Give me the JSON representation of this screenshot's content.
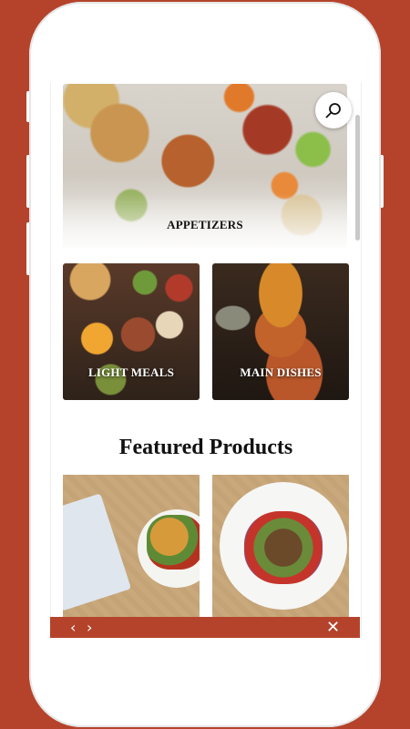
{
  "colors": {
    "accent": "#b5432b",
    "frame": "#ffffff"
  },
  "categories": [
    {
      "label": "APPETIZERS"
    },
    {
      "label": "LIGHT MEALS"
    },
    {
      "label": "MAIN DISHES"
    }
  ],
  "search": {
    "icon": "search-icon"
  },
  "featured": {
    "title": "Featured Products",
    "products": [
      {
        "image": "samosa-plate-photo"
      },
      {
        "image": "grilled-meat-plate-photo"
      }
    ]
  },
  "navbar": {
    "back_icon": "‹",
    "forward_icon": "›",
    "close_icon": "✕"
  }
}
